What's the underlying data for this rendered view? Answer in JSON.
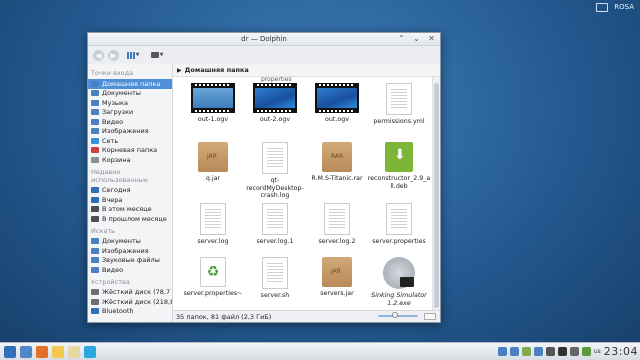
{
  "desktop": {
    "user_label": "ROSA"
  },
  "window": {
    "title": "dr — Dolphin",
    "buttons": [
      "⌃",
      "⌄",
      "✕"
    ]
  },
  "toolbar": {
    "back": "◀",
    "forward": "▶",
    "dropdown": "▼"
  },
  "places": {
    "groups": [
      {
        "title": "Точки входа",
        "items": [
          {
            "label": "Домашняя папка",
            "color": "#4a7fc1",
            "selected": true
          },
          {
            "label": "Документы",
            "color": "#4a7fc1"
          },
          {
            "label": "Музыка",
            "color": "#4a7fc1"
          },
          {
            "label": "Загрузки",
            "color": "#4a7fc1"
          },
          {
            "label": "Видео",
            "color": "#4a7fc1"
          },
          {
            "label": "Изображения",
            "color": "#4a7fc1"
          },
          {
            "label": "Сеть",
            "color": "#3a8fd6"
          },
          {
            "label": "Корневая папка",
            "color": "#c94040"
          },
          {
            "label": "Корзина",
            "color": "#8a8f96"
          }
        ]
      },
      {
        "title": "Недавно использованные",
        "items": [
          {
            "label": "Сегодня",
            "color": "#2f6fb8"
          },
          {
            "label": "Вчера",
            "color": "#2f6fb8"
          },
          {
            "label": "В этом месяце",
            "color": "#4a4f57"
          },
          {
            "label": "В прошлом месяце",
            "color": "#4a4f57"
          }
        ]
      },
      {
        "title": "Искать",
        "items": [
          {
            "label": "Документы",
            "color": "#4a7fc1"
          },
          {
            "label": "Изображения",
            "color": "#4a7fc1"
          },
          {
            "label": "Звуковые файлы",
            "color": "#4a7fc1"
          },
          {
            "label": "Видео",
            "color": "#4a7fc1"
          }
        ]
      },
      {
        "title": "Устройства",
        "items": [
          {
            "label": "Жёсткий диск (78,7 ГиБ)",
            "color": "#6b7077"
          },
          {
            "label": "Жёсткий диск (218,8 ГиБ)",
            "color": "#6b7077"
          },
          {
            "label": "Bluetooth",
            "color": "#2f6fb8"
          }
        ]
      }
    ]
  },
  "breadcrumb": {
    "arrow": "▶",
    "label": "Домашняя папка"
  },
  "partial_label": "properties",
  "files": [
    {
      "name": "out-1.ogv",
      "kind": "video-first"
    },
    {
      "name": "out-2.ogv",
      "kind": "video"
    },
    {
      "name": "out.ogv",
      "kind": "video"
    },
    {
      "name": "permissions.yml",
      "kind": "doc"
    },
    {
      "name": "q.jar",
      "kind": "jar"
    },
    {
      "name": "qt-recordMyDesktop-crash.log",
      "kind": "doc"
    },
    {
      "name": "R.M.S-Titanic.rar",
      "kind": "rar"
    },
    {
      "name": "reconstructor_2.9_all.deb",
      "kind": "deb"
    },
    {
      "name": "server.log",
      "kind": "doc"
    },
    {
      "name": "server.log.1",
      "kind": "doc"
    },
    {
      "name": "server.log.2",
      "kind": "doc"
    },
    {
      "name": "server.properties",
      "kind": "doc"
    },
    {
      "name": "server.properties~",
      "kind": "recycle"
    },
    {
      "name": "server.sh",
      "kind": "doc"
    },
    {
      "name": "servers.jar",
      "kind": "jar"
    },
    {
      "name": "Sinking Simulator 1.2.exe",
      "kind": "exe"
    },
    {
      "name": "",
      "kind": "wav"
    },
    {
      "name": "",
      "kind": "doc"
    },
    {
      "name": "",
      "kind": "doc"
    },
    {
      "name": "",
      "kind": "doc"
    }
  ],
  "icon_tags": {
    "jar": "JAR",
    "rar": "RAR",
    "wav": "WAV",
    "deb_arrow": "⬇",
    "recycle": "♻",
    "note": "♫"
  },
  "status": {
    "text": "35 папок, 81 файл (2,3 ГиБ)"
  },
  "taskbar": {
    "launchers": [
      {
        "name": "menu-icon",
        "color": "#2f6fb8"
      },
      {
        "name": "desktop-icon",
        "color": "#4f86c7"
      },
      {
        "name": "firefox-icon",
        "color": "#e0702a"
      },
      {
        "name": "folder-icon",
        "color": "#f2c94c"
      },
      {
        "name": "mail-icon",
        "color": "#e9d7a3"
      },
      {
        "name": "skype-icon",
        "color": "#2aa7e0"
      }
    ],
    "tray_icons": [
      {
        "name": "network-icon",
        "color": "#4a7fc1"
      },
      {
        "name": "files-icon",
        "color": "#4a7fc1"
      },
      {
        "name": "chat-icon",
        "color": "#7fa94a"
      },
      {
        "name": "dolphin-task-icon",
        "color": "#4a7fc1"
      },
      {
        "name": "screen-icon",
        "color": "#555"
      },
      {
        "name": "record-icon",
        "color": "#333"
      },
      {
        "name": "power-icon",
        "color": "#666"
      },
      {
        "name": "tools-icon",
        "color": "#5a9a3a"
      }
    ],
    "keyboard_layout": "us",
    "clock": "23:04"
  }
}
